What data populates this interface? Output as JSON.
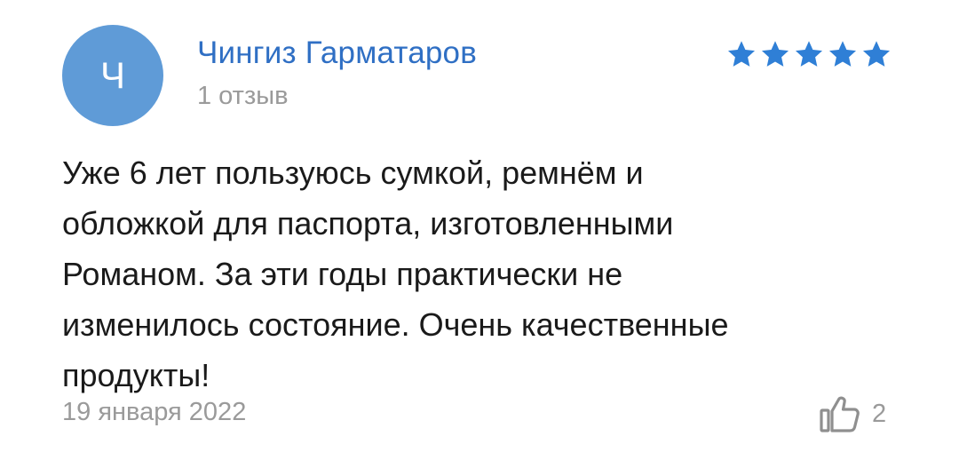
{
  "review": {
    "avatar_initial": "Ч",
    "author_name": "Чингиз Гарматаров",
    "review_count": "1 отзыв",
    "rating": 5,
    "text_lines": [
      "Уже 6 лет пользуюсь сумкой, ремнём и",
      "обложкой для паспорта, изготовленными",
      "Романом. За эти годы практически не",
      "изменилось состояние. Очень качественные",
      "продукты!"
    ],
    "date": "19 января 2022",
    "likes": "2"
  },
  "colors": {
    "accent": "#2f6fc4",
    "avatar": "#5f9bd7",
    "star": "#2f7fd6",
    "muted": "#9a9a9a"
  },
  "icons": {
    "star": "star-icon",
    "like": "thumbs-up-icon"
  }
}
